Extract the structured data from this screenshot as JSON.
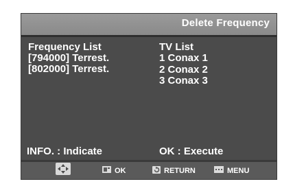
{
  "header": {
    "title": "Delete Frequency"
  },
  "frequency_list": {
    "heading": "Frequency List",
    "items": [
      "[794000] Terrest.",
      "[802000] Terrest."
    ]
  },
  "tv_list": {
    "heading": "TV List",
    "items": [
      "1 Conax 1",
      "2 Conax 2",
      "3 Conax 3"
    ]
  },
  "footer": {
    "info_hint": "INFO. : Indicate",
    "ok_hint": "OK : Execute"
  },
  "help_bar": {
    "ok_label": "OK",
    "return_label": "RETURN",
    "menu_label": "MENU",
    "icons": [
      "navigation-icon",
      "ok-icon",
      "return-icon",
      "menu-icon"
    ]
  }
}
